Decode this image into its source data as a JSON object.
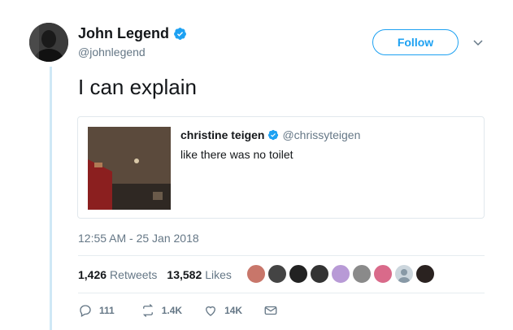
{
  "author": {
    "name": "John Legend",
    "handle": "@johnlegend",
    "verified": true
  },
  "follow_label": "Follow",
  "tweet_text": "I can explain",
  "quoted": {
    "name": "christine teigen",
    "handle": "@chrissyteigen",
    "verified": true,
    "text": "like there was no toilet"
  },
  "timestamp": "12:55 AM - 25 Jan 2018",
  "stats": {
    "retweets_count": "1,426",
    "retweets_label": "Retweets",
    "likes_count": "13,582",
    "likes_label": "Likes"
  },
  "actions": {
    "reply_count": "111",
    "retweet_count": "1.4K",
    "like_count": "14K"
  },
  "colors": {
    "brand_blue": "#1da1f2",
    "secondary_text": "#657786",
    "thread_line": "#cfe8f6"
  }
}
